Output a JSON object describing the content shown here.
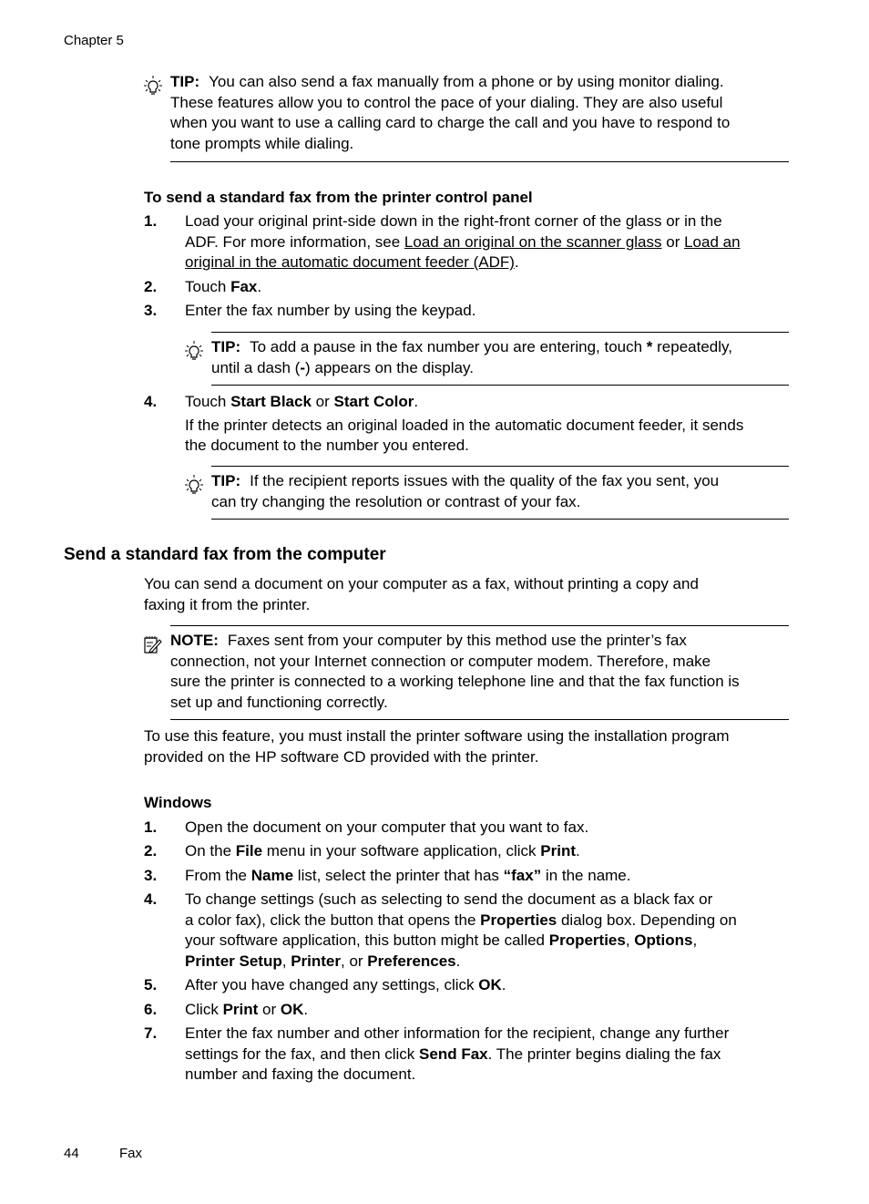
{
  "header": {
    "chapter": "Chapter 5"
  },
  "footer": {
    "page_number": "44",
    "section": "Fax"
  },
  "tip1": {
    "icon": "lightbulb-icon",
    "label": "TIP:",
    "lines": [
      "You can also send a fax manually from a phone or by using monitor dialing.",
      "These features allow you to control the pace of your dialing. They are also useful",
      "when you want to use a calling card to charge the call and you have to respond to",
      "tone prompts while dialing."
    ]
  },
  "control_panel": {
    "heading": "To send a standard fax from the printer control panel",
    "steps": [
      {
        "num": "1.",
        "line1": "Load your original print-side down in the right-front corner of the glass or in the",
        "line2_pre": "ADF. For more information, see ",
        "link1": "Load an original on the scanner glass",
        "mid": " or ",
        "link2a": "Load an",
        "link2b": "original in the automatic document feeder (ADF)",
        "end": "."
      },
      {
        "num": "2.",
        "pre": "Touch ",
        "bold": "Fax",
        "post": "."
      },
      {
        "num": "3.",
        "text": "Enter the fax number by using the keypad."
      },
      {
        "num": "4.",
        "pre": "Touch ",
        "bold1": "Start Black",
        "mid": " or ",
        "bold2": "Start Color",
        "post": ".",
        "detail_lines": [
          "If the printer detects an original loaded in the automatic document feeder, it sends",
          "the document to the number you entered."
        ]
      }
    ],
    "tip2": {
      "label": "TIP:",
      "line1_pre": "To add a pause in the fax number you are entering, touch ",
      "star": "*",
      "line1_post": " repeatedly,",
      "line2_pre": "until a dash (",
      "dash": "-",
      "line2_post": ") appears on the display."
    },
    "tip3": {
      "label": "TIP:",
      "lines": [
        "If the recipient reports issues with the quality of the fax you sent, you",
        "can try changing the resolution or contrast of your fax."
      ]
    }
  },
  "computer_section": {
    "heading": "Send a standard fax from the computer",
    "intro_lines": [
      "You can send a document on your computer as a fax, without printing a copy and",
      "faxing it from the printer."
    ],
    "note": {
      "icon": "note-pencil-icon",
      "label": "NOTE:",
      "lines": [
        "Faxes sent from your computer by this method use the printer’s fax",
        "connection, not your Internet connection or computer modem. Therefore, make",
        "sure the printer is connected to a working telephone line and that the fax function is",
        "set up and functioning correctly."
      ]
    },
    "install_lines": [
      "To use this feature, you must install the printer software using the installation program",
      "provided on the HP software CD provided with the printer."
    ],
    "windows": {
      "heading": "Windows",
      "steps": [
        {
          "num": "1.",
          "text": "Open the document on your computer that you want to fax."
        },
        {
          "num": "2.",
          "a": "On the ",
          "b1": "File",
          "c": " menu in your software application, click ",
          "b2": "Print",
          "d": "."
        },
        {
          "num": "3.",
          "a": "From the ",
          "b1": "Name",
          "c": " list, select the printer that has ",
          "b2": "“fax”",
          "d": " in the name."
        },
        {
          "num": "4.",
          "l1": "To change settings (such as selecting to send the document as a black fax or",
          "l2a": "a color fax), click the button that opens the ",
          "l2b": "Properties",
          "l2c": " dialog box. Depending on",
          "l3a": "your software application, this button might be called ",
          "l3b": "Properties",
          "l3c": ", ",
          "l3d": "Options",
          "l3e": ",",
          "l4a": "Printer Setup",
          "l4b": ", ",
          "l4c": "Printer",
          "l4d": ", or ",
          "l4e": "Preferences",
          "l4f": "."
        },
        {
          "num": "5.",
          "a": "After you have changed any settings, click ",
          "b1": "OK",
          "d": "."
        },
        {
          "num": "6.",
          "a": "Click ",
          "b1": "Print",
          "c": " or ",
          "b2": "OK",
          "d": "."
        },
        {
          "num": "7.",
          "l1": "Enter the fax number and other information for the recipient, change any further",
          "l2a": "settings for the fax, and then click ",
          "l2b": "Send Fax",
          "l2c": ". The printer begins dialing the fax",
          "l3": "number and faxing the document."
        }
      ]
    }
  }
}
